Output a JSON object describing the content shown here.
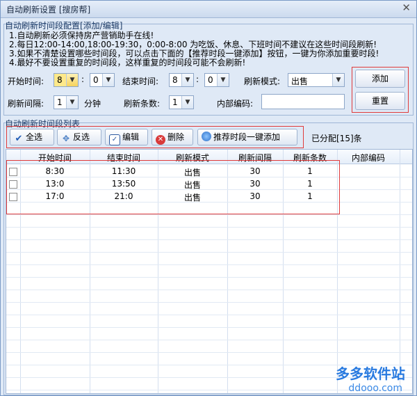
{
  "window": {
    "title": "自动刷新设置 [搜房帮]",
    "close": "✕"
  },
  "config": {
    "group_title": "自动刷新时间段配置[添加/编辑]",
    "notes": [
      "1.自动刷新必须保持房产营销助手在线!",
      "2.每日12:00-14:00,18:00-19:30，0:00-8:00 为吃饭、休息、下班时间不建议在这些时间段刷新!",
      "3.如果不清楚设置哪些时间段，可以点击下面的【推荐时段一键添加】按钮，一键为你添加重要时段!",
      "4.最好不要设置重复的时间段，这样重复的时间段可能不会刷新!"
    ],
    "start_label": "开始时间:",
    "start_hour": "8",
    "start_min": "0",
    "end_label": "结束时间:",
    "end_hour": "8",
    "end_min": "0",
    "mode_label": "刷新模式:",
    "mode_value": "出售",
    "interval_label": "刷新间隔:",
    "interval_value": "1",
    "interval_unit": "分钟",
    "count_label": "刷新条数:",
    "count_value": "1",
    "code_label": "内部编码:",
    "code_value": "",
    "colon": ":",
    "add_button": "添加",
    "reset_button": "重置"
  },
  "list": {
    "group_title": "自动刷新时间段列表",
    "toolbar": {
      "select_all": "全选",
      "invert": "反选",
      "edit": "编辑",
      "delete": "删除",
      "recommend": "推荐时段一键添加",
      "allocated": "已分配[15]条"
    },
    "columns": [
      "开始时间",
      "结束时间",
      "刷新模式",
      "刷新间隔",
      "刷新条数",
      "内部编码"
    ],
    "rows": [
      {
        "start": "8:30",
        "end": "11:30",
        "mode": "出售",
        "interval": "30",
        "count": "1",
        "code": ""
      },
      {
        "start": "13:0",
        "end": "13:50",
        "mode": "出售",
        "interval": "30",
        "count": "1",
        "code": ""
      },
      {
        "start": "17:0",
        "end": "21:0",
        "mode": "出售",
        "interval": "30",
        "count": "1",
        "code": ""
      }
    ]
  },
  "watermark": {
    "line1": "多多软件站",
    "line2": "ddooo.com"
  },
  "colors": {
    "highlight_box": "#e03a3a",
    "accent": "#ffe98a"
  }
}
